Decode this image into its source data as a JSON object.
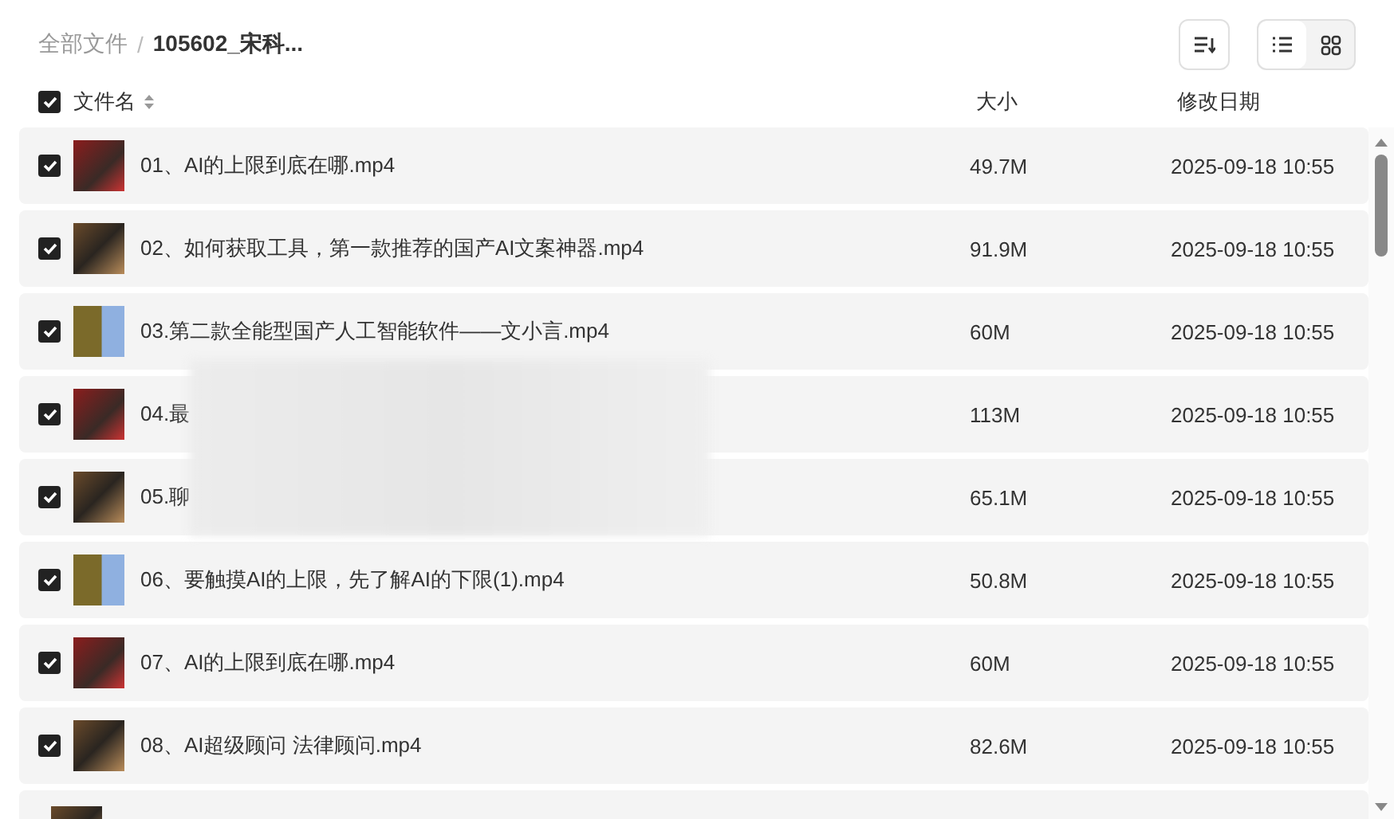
{
  "breadcrumb": [
    {
      "label": "全部文件",
      "current": false
    },
    {
      "label": "105602_宋科...",
      "current": true
    }
  ],
  "breadcrumb_separator": "/",
  "view_toggle": [
    {
      "kind": "list",
      "selected": true
    },
    {
      "kind": "grid",
      "selected": false
    }
  ],
  "table": {
    "select_all": {
      "checked": true
    },
    "columns": [
      {
        "label": "文件名",
        "sortable": true
      },
      {
        "label": "大小",
        "sortable": false
      },
      {
        "label": "修改日期",
        "sortable": false
      }
    ],
    "rows": [
      {
        "name": "01、AI的上限到底在哪.mp4",
        "size": "49.7M",
        "date": "2025-09-18 10:55",
        "checked": true
      },
      {
        "name": "02、如何获取工具，第一款推荐的国产AI文案神器.mp4",
        "size": "91.9M",
        "date": "2025-09-18 10:55",
        "checked": true
      },
      {
        "name": "03.第二款全能型国产人工智能软件——文小言.mp4",
        "size": "60M",
        "date": "2025-09-18 10:55",
        "checked": true
      },
      {
        "name": "04.最",
        "size": "113M",
        "date": "2025-09-18 10:55",
        "checked": true
      },
      {
        "name": "05.聊",
        "size": "65.1M",
        "date": "2025-09-18 10:55",
        "checked": true
      },
      {
        "name": "06、要触摸AI的上限，先了解AI的下限(1).mp4",
        "size": "50.8M",
        "date": "2025-09-18 10:55",
        "checked": true
      },
      {
        "name": "07、AI的上限到底在哪.mp4",
        "size": "60M",
        "date": "2025-09-18 10:55",
        "checked": true
      },
      {
        "name": "08、AI超级顾问 法律顾问.mp4",
        "size": "82.6M",
        "date": "2025-09-18 10:55",
        "checked": true
      }
    ]
  }
}
